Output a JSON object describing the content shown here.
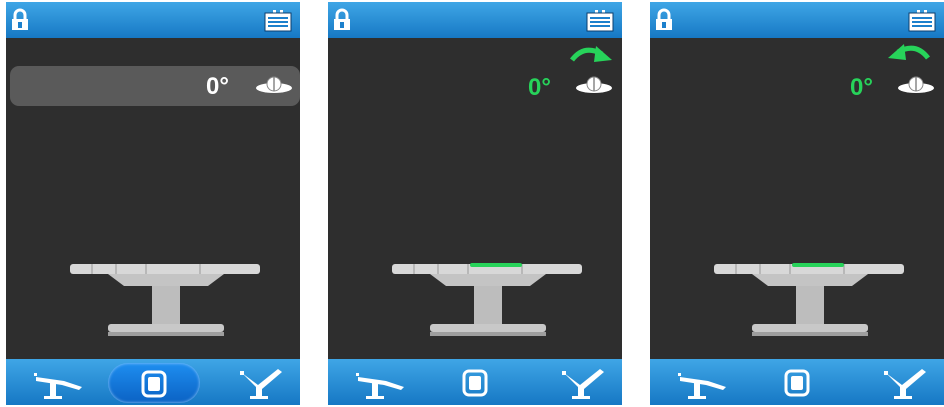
{
  "screens": [
    {
      "angle": "0°",
      "mode": "panel",
      "arrow": "none",
      "active_nav": "center"
    },
    {
      "angle": "0°",
      "mode": "green",
      "arrow": "right",
      "active_nav": "none"
    },
    {
      "angle": "0°",
      "mode": "green",
      "arrow": "left",
      "active_nav": "none"
    }
  ],
  "icons": {
    "lock": "lock-icon",
    "battery": "battery-icon",
    "tilt": "lateral-tilt-icon",
    "arrow": "curved-arrow-icon",
    "nav_left": "table-back-section-icon",
    "nav_center": "table-overview-icon",
    "nav_right": "table-leg-section-icon"
  },
  "colors": {
    "bar_blue": "#1678c4",
    "screen_bg": "#2e2e2e",
    "highlight_green": "#27d35a",
    "panel_gray": "#5a5a5a"
  }
}
